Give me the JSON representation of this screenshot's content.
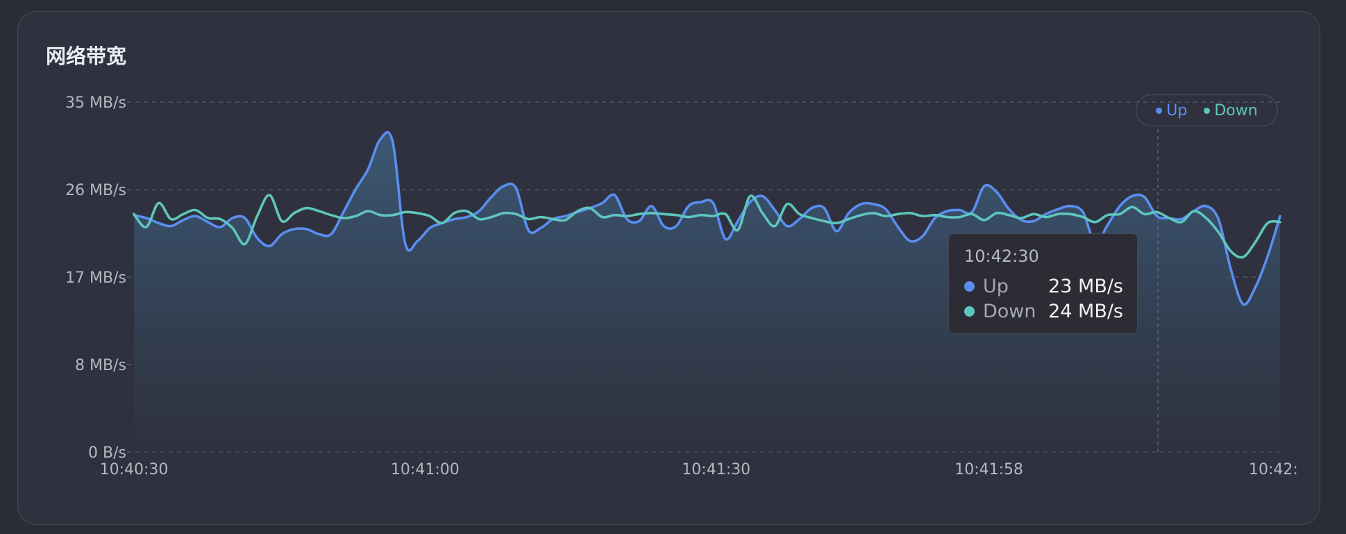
{
  "panel": {
    "title": "网络带宽"
  },
  "colors": {
    "up": "#5a8ef0",
    "down": "#5ec6bd",
    "grid": "#5b5f6c",
    "tick_text": "#b5b8c2"
  },
  "chart_data": {
    "type": "line",
    "title": "网络带宽",
    "xlabel": "",
    "ylabel": "",
    "y_ticks": [
      "0 B/s",
      "8 MB/s",
      "17 MB/s",
      "26 MB/s",
      "35 MB/s"
    ],
    "y_tick_values": [
      0,
      8.75,
      17.5,
      26.25,
      35
    ],
    "ylim": [
      0,
      35
    ],
    "x_ticks": [
      "10:40:30",
      "10:41:00",
      "10:41:30",
      "10:41:58",
      "10:42:"
    ],
    "x_tick_positions": [
      0,
      0.254,
      0.508,
      0.746,
      1.0
    ],
    "grid": true,
    "legend_position": "top-right",
    "series": [
      {
        "name": "Up",
        "color": "#5a8ef0",
        "values": [
          23.7,
          23.4,
          22.9,
          22.6,
          23.2,
          23.6,
          23.0,
          22.5,
          23.4,
          23.4,
          21.4,
          20.6,
          21.8,
          22.3,
          22.3,
          21.8,
          21.8,
          24.0,
          26.3,
          28.3,
          31.3,
          31.0,
          20.9,
          21.1,
          22.4,
          22.9,
          23.3,
          23.5,
          24.1,
          25.5,
          26.6,
          26.4,
          22.2,
          22.4,
          23.3,
          23.6,
          24.0,
          24.4,
          24.9,
          25.7,
          23.3,
          23.1,
          24.6,
          22.6,
          22.6,
          24.6,
          25.0,
          24.9,
          21.3,
          23.1,
          25.0,
          25.6,
          24.2,
          22.6,
          23.3,
          24.4,
          24.4,
          22.1,
          23.9,
          24.8,
          24.8,
          24.3,
          22.5,
          21.1,
          21.6,
          23.4,
          24.1,
          24.2,
          24.0,
          26.6,
          26.0,
          24.3,
          23.2,
          23.1,
          23.8,
          24.3,
          24.6,
          24.0,
          20.9,
          22.7,
          24.6,
          25.6,
          25.5,
          23.6,
          23.4,
          23.3,
          24.1,
          24.6,
          23.3,
          18.3,
          14.8,
          16.5,
          19.6,
          23.6
        ]
      },
      {
        "name": "Down",
        "color": "#5ec6bd",
        "values": [
          23.8,
          22.5,
          24.9,
          23.3,
          23.8,
          24.2,
          23.4,
          23.3,
          22.4,
          20.8,
          23.6,
          25.7,
          23.1,
          23.9,
          24.4,
          24.1,
          23.7,
          23.4,
          23.6,
          24.1,
          23.7,
          23.7,
          24.0,
          23.9,
          23.6,
          22.9,
          23.9,
          24.1,
          23.3,
          23.5,
          23.9,
          23.8,
          23.3,
          23.5,
          23.3,
          23.2,
          24.1,
          24.4,
          23.5,
          23.7,
          23.6,
          23.8,
          23.9,
          23.8,
          23.7,
          23.5,
          23.7,
          23.6,
          23.8,
          22.2,
          25.6,
          23.9,
          22.6,
          24.8,
          23.8,
          23.4,
          23.1,
          22.9,
          23.3,
          23.7,
          23.9,
          23.6,
          23.8,
          23.9,
          23.6,
          23.7,
          23.5,
          23.5,
          23.8,
          23.2,
          23.9,
          23.7,
          23.4,
          23.8,
          23.5,
          23.8,
          23.8,
          23.5,
          23.0,
          23.7,
          23.8,
          24.5,
          23.8,
          24.0,
          23.4,
          23.0,
          24.1,
          23.4,
          22.0,
          20.1,
          19.5,
          21.0,
          22.9,
          23.0
        ]
      }
    ]
  },
  "legend": {
    "items": [
      {
        "label": "Up",
        "color": "#5a8ef0"
      },
      {
        "label": "Down",
        "color": "#5ec6bd"
      }
    ]
  },
  "tooltip": {
    "time": "10:42:30",
    "rows": [
      {
        "label": "Up",
        "value": "23 MB/s",
        "color": "#5a8ef0"
      },
      {
        "label": "Down",
        "value": "24 MB/s",
        "color": "#5ec6bd"
      }
    ]
  }
}
